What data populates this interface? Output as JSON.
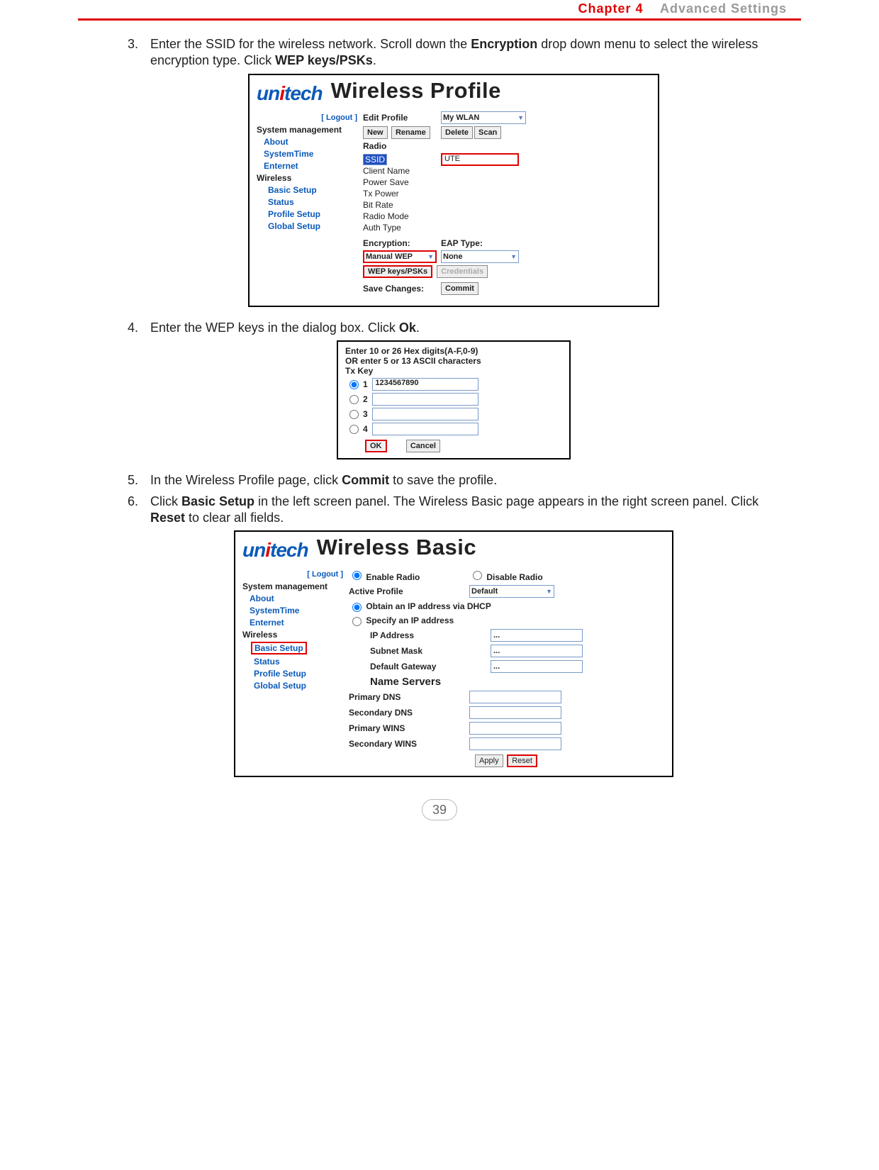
{
  "header": {
    "chapter_red": "Chapter 4",
    "chapter_gray": "Advanced Settings"
  },
  "steps": {
    "s3num": "3.",
    "s3a": "Enter the SSID for the wireless network. Scroll down the ",
    "s3b": "Encryption",
    "s3c": " drop down menu to select the wireless encryption type. Click ",
    "s3d": "WEP keys/PSKs",
    "s3e": ".",
    "s4num": "4.",
    "s4a": "Enter the WEP keys in the dialog box. Click ",
    "s4b": "Ok",
    "s4c": ".",
    "s5num": "5.",
    "s5a": "In the Wireless Profile page, click ",
    "s5b": "Commit",
    "s5c": " to save the profile.",
    "s6num": "6.",
    "s6a": "Click ",
    "s6b": "Basic Setup",
    "s6c": " in the left screen panel. The Wireless Basic page appears in the right screen panel. Click ",
    "s6d": "Reset",
    "s6e": " to clear all fields."
  },
  "logo": {
    "text_prefix": "un",
    "dot": "i",
    "text_suffix": "tech"
  },
  "shot1": {
    "title": "Wireless Profile",
    "logout": "[ Logout ]",
    "side": {
      "cat": "System management",
      "about": "About",
      "systemtime": "SystemTime",
      "enternet": "Enternet",
      "wireless": "Wireless",
      "basic": "Basic Setup",
      "status": "Status",
      "profile": "Profile Setup",
      "global": "Global Setup"
    },
    "editprofile": "Edit Profile",
    "mywlan": "My WLAN",
    "new": "New",
    "rename": "Rename",
    "delete": "Delete",
    "scan": "Scan",
    "radio": "Radio",
    "ssid": "SSID",
    "ssid_val": "UTE",
    "clientname": "Client Name",
    "powersave": "Power Save",
    "txpower": "Tx Power",
    "bitrate": "Bit Rate",
    "radiomode": "Radio Mode",
    "authtype": "Auth Type",
    "encryption": "Encryption:",
    "eaptype": "EAP Type:",
    "enc_val": "Manual WEP",
    "eap_val": "None",
    "wepkeys": "WEP keys/PSKs",
    "credentials": "Credentials",
    "savechanges": "Save Changes:",
    "commit": "Commit"
  },
  "shot2": {
    "line1": "Enter 10 or 26 Hex digits(A-F,0-9)",
    "line2": "OR enter 5 or 13 ASCII characters",
    "txkey": "Tx Key",
    "k1": "1",
    "k1v": "1234567890",
    "k2": "2",
    "k3": "3",
    "k4": "4",
    "ok": "OK",
    "cancel": "Cancel"
  },
  "shot3": {
    "title": "Wireless Basic",
    "logout": "[ Logout ]",
    "side": {
      "cat": "System management",
      "about": "About",
      "systemtime": "SystemTime",
      "enternet": "Enternet",
      "wireless": "Wireless",
      "basic": "Basic Setup",
      "status": "Status",
      "profile": "Profile Setup",
      "global": "Global Setup"
    },
    "enable": "Enable Radio",
    "disable": "Disable Radio",
    "activeprofile": "Active Profile",
    "default": "Default",
    "obtain": "Obtain an IP address via DHCP",
    "specify": "Specify an IP address",
    "ip": "IP Address",
    "subnet": "Subnet Mask",
    "gateway": "Default Gateway",
    "nameservers": "Name Servers",
    "pdns": "Primary DNS",
    "sdns": "Secondary DNS",
    "pwins": "Primary WINS",
    "swins": "Secondary WINS",
    "apply": "Apply",
    "reset": "Reset",
    "dots": "..."
  },
  "pagenum": "39"
}
